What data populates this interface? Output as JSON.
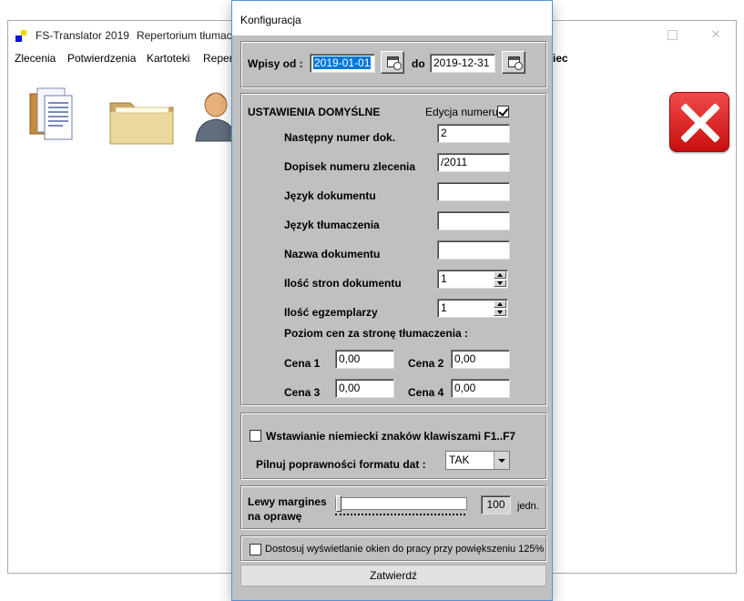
{
  "main_window": {
    "app_name": "FS-Translator 2019",
    "subtitle": "Repertorium tłumac",
    "menu": [
      {
        "label": "Zlecenia"
      },
      {
        "label": "Potwierdzenia"
      },
      {
        "label": "Kartoteki"
      },
      {
        "label": "Reper"
      },
      {
        "label": "iec"
      }
    ],
    "toolbar_icons": [
      "document-icon",
      "folder-icon",
      "person-icon",
      "exit-icon"
    ]
  },
  "dialog": {
    "title": "Konfiguracja",
    "date_range": {
      "from_label": "Wpisy od :",
      "from_value": "2019-01-01",
      "to_label": "do",
      "to_value": "2019-12-31"
    },
    "defaults": {
      "heading": "USTAWIENIA DOMYŚLNE",
      "edit_number_label": "Edycja numeru",
      "edit_number_checked": true,
      "next_number_label": "Następny numer dok.",
      "next_number_value": "2",
      "suffix_label": "Dopisek numeru zlecenia",
      "suffix_value": "/2011",
      "doc_lang_label": "Język dokumentu",
      "doc_lang_value": "",
      "trans_lang_label": "Język tłumaczenia",
      "trans_lang_value": "",
      "doc_name_label": "Nazwa dokumentu",
      "doc_name_value": "",
      "pages_label": "Ilość stron dokumentu",
      "pages_value": "1",
      "copies_label": "Ilość egzemplarzy",
      "copies_value": "1",
      "price_level_label": "Poziom cen za stronę tłumaczenia :",
      "price1_label": "Cena 1",
      "price1_value": "0,00",
      "price2_label": "Cena 2",
      "price2_value": "0,00",
      "price3_label": "Cena 3",
      "price3_value": "0,00",
      "price4_label": "Cena 4",
      "price4_value": "0,00"
    },
    "german_chars": {
      "label": "Wstawianie niemiecki znaków  klawiszami F1..F7",
      "checked": false
    },
    "date_format": {
      "label": "Pilnuj poprawności formatu dat :",
      "value": "TAK"
    },
    "margin": {
      "label_line1": "Lewy margines",
      "label_line2": "na oprawę",
      "value": "100",
      "unit": "jedn.",
      "slider_level": 0
    },
    "scaling": {
      "label": "Dostosuj wyświetlanie okien do pracy przy powiększeniu 125%",
      "checked": false
    },
    "submit_label": "Zatwierdź"
  },
  "colors": {
    "dialog_body": "#c0c0c0",
    "selection": "#0078d7",
    "exit_red": "#d81b1b"
  }
}
